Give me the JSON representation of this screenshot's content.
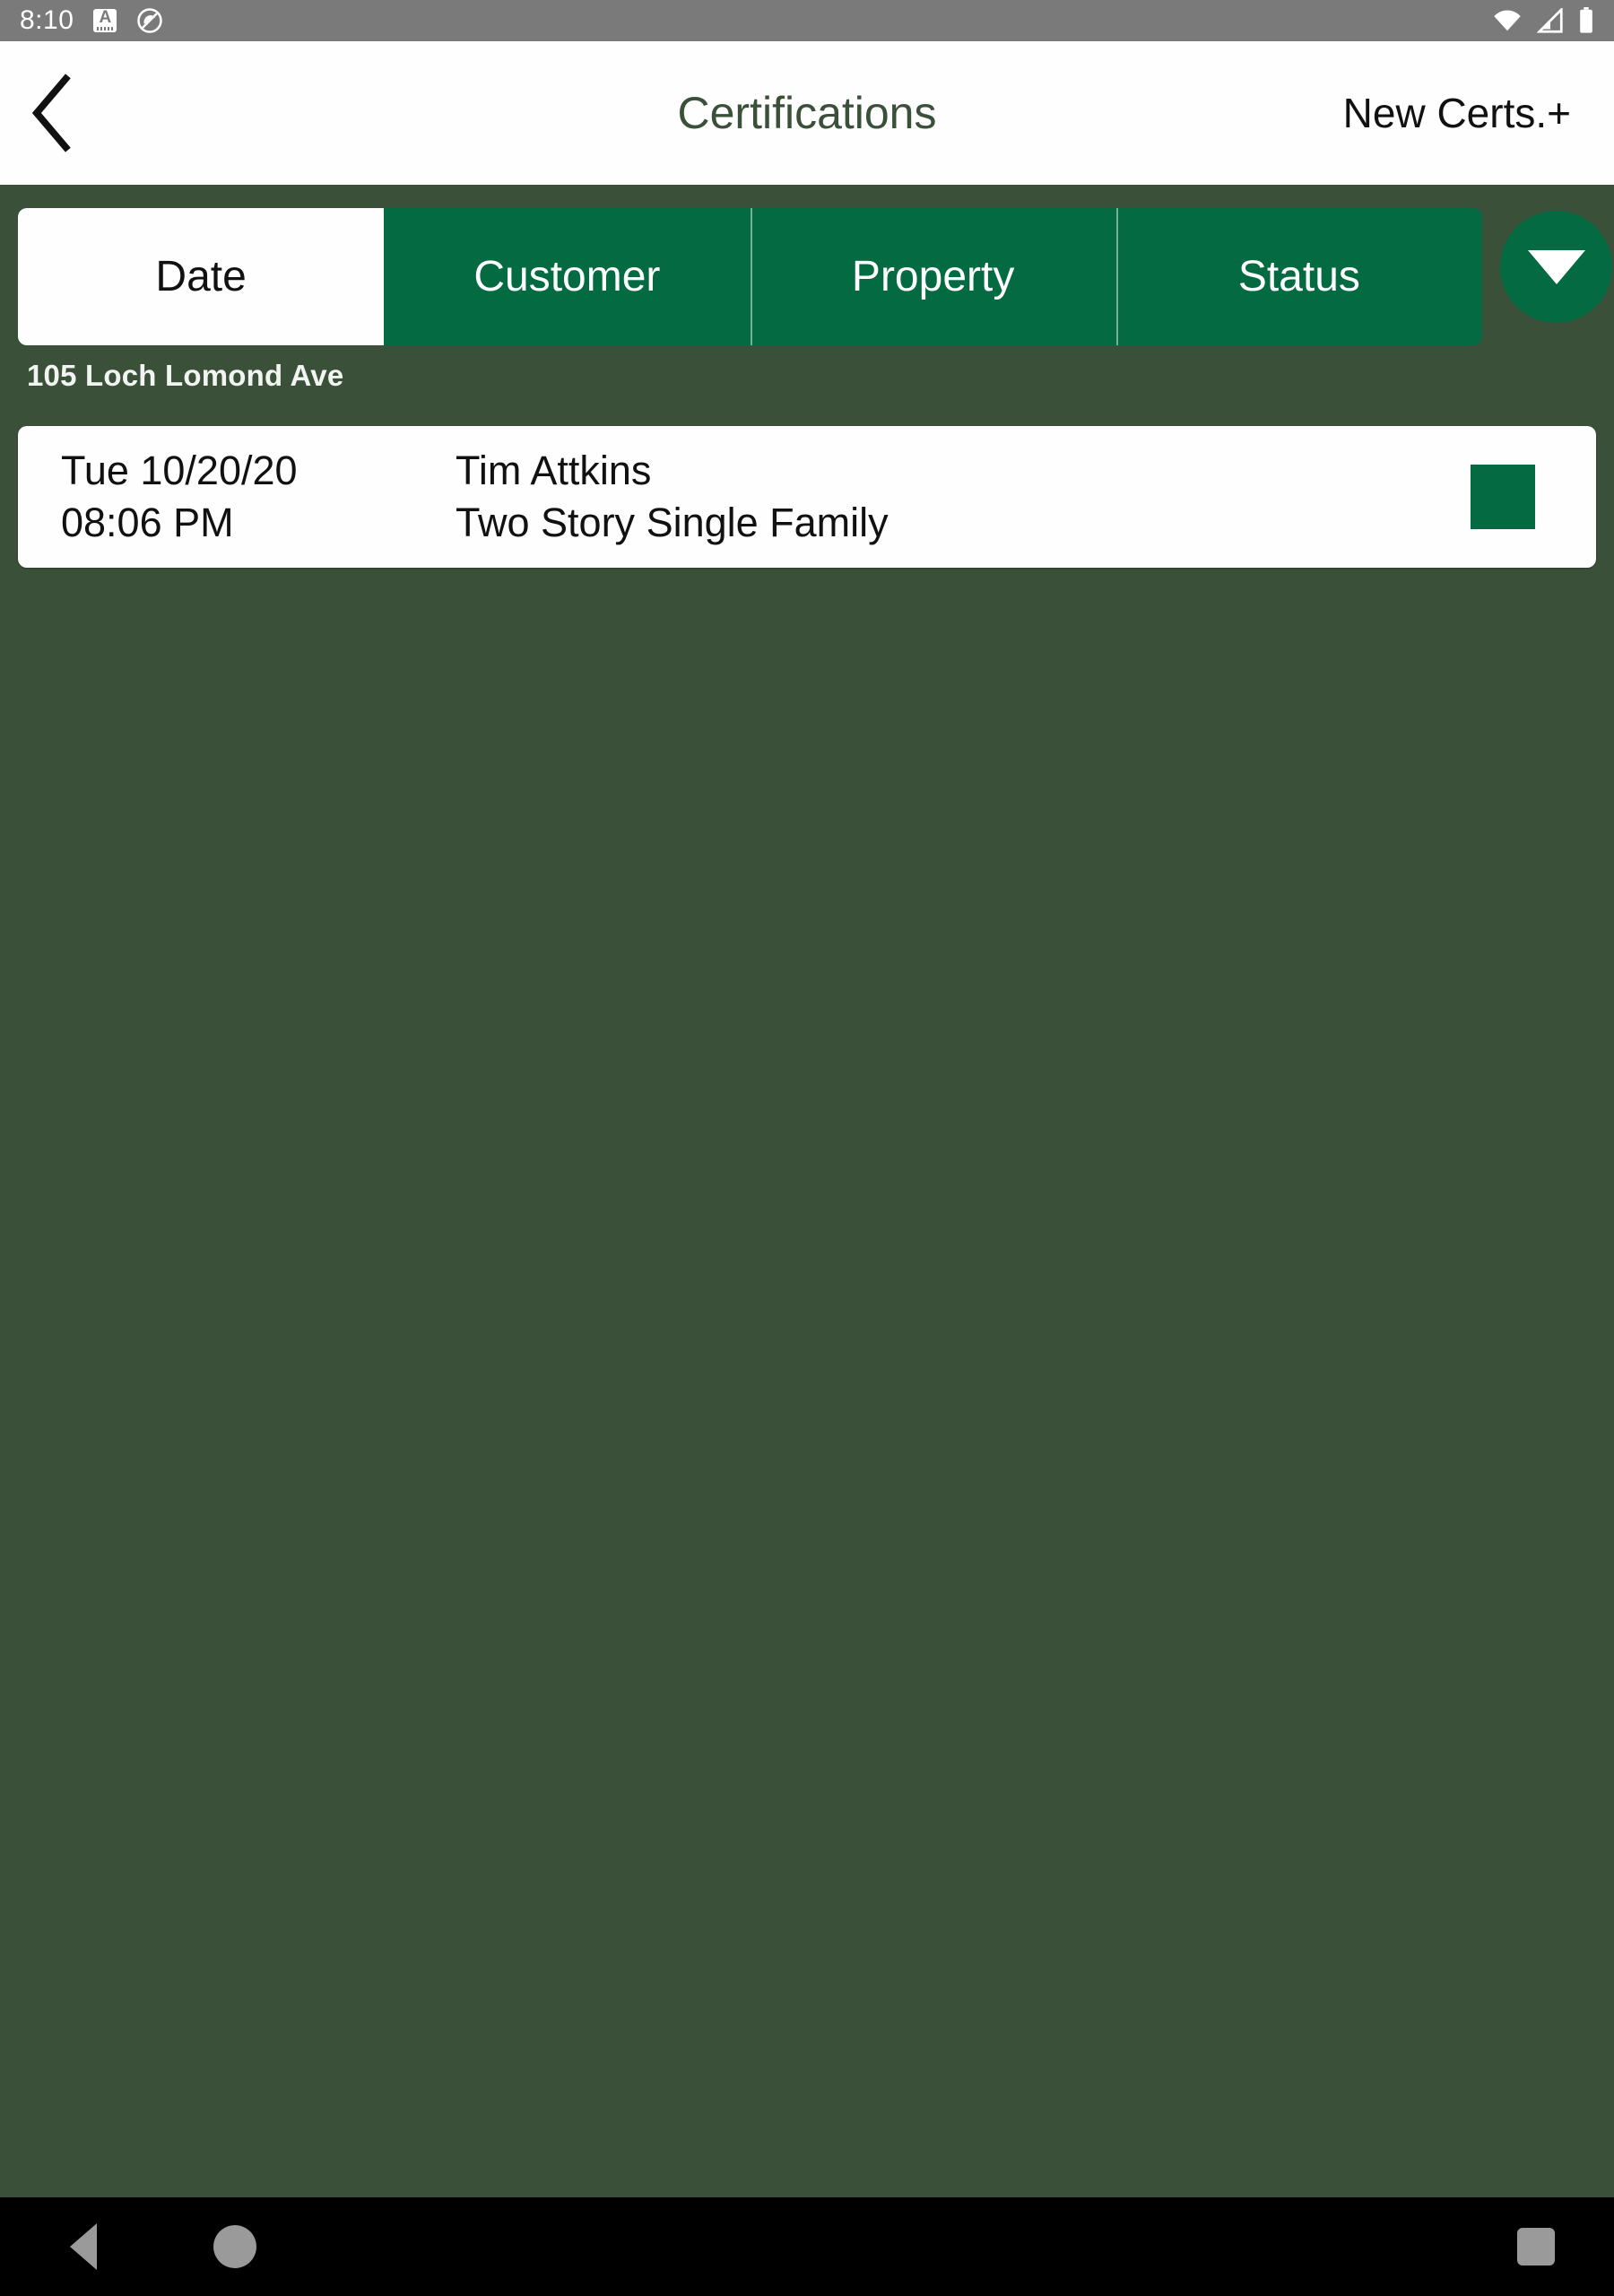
{
  "status_bar": {
    "time": "8:10",
    "badge_letter": "A",
    "icons": [
      "text-badge-icon",
      "do-not-disturb-icon",
      "wifi-icon",
      "cellular-signal-icon",
      "battery-icon"
    ]
  },
  "header": {
    "back_icon": "chevron-left-icon",
    "title": "Certifications",
    "action_label": "New Certs.+"
  },
  "tabs": {
    "items": [
      {
        "label": "Date",
        "active": true
      },
      {
        "label": "Customer",
        "active": false
      },
      {
        "label": "Property",
        "active": false
      },
      {
        "label": "Status",
        "active": false
      }
    ],
    "dropdown_icon": "chevron-down-icon"
  },
  "groups": [
    {
      "header": "105 Loch Lomond Ave",
      "rows": [
        {
          "date": "Tue 10/20/20",
          "time": "08:06 PM",
          "customer": "Tim Attkins",
          "property": "Two Story Single Family",
          "status_color": "#046a42"
        }
      ]
    }
  ],
  "nav_bar": {
    "back_icon": "triangle-back-icon",
    "home_icon": "circle-home-icon",
    "recents_icon": "square-recents-icon"
  },
  "colors": {
    "page_background": "#3a5039",
    "accent_green": "#046a42",
    "header_background": "#fefefe",
    "title_green": "#3a5039",
    "status_bar_gray": "#7a7a7a",
    "nav_bar_black": "#000000",
    "nav_icon_gray": "#9a9a9a"
  }
}
